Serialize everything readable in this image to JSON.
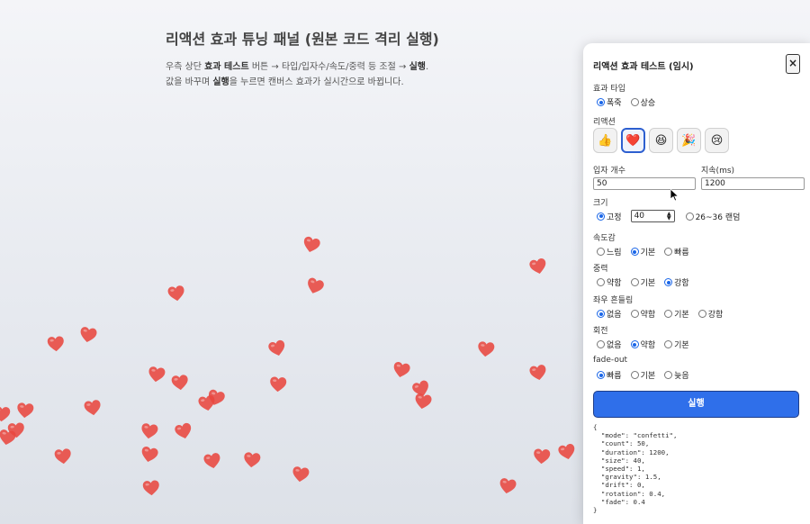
{
  "intro": {
    "title": "리액션 효과 튜닝 패널 (원본 코드 격리 실행)",
    "line1_a": "우측 상단 ",
    "line1_b": "효과 테스트",
    "line1_c": " 버튼 → 타입/입자수/속도/중력 등 조절 → ",
    "line1_d": "실행",
    "line1_e": ".",
    "line2_a": "값을 바꾸며 ",
    "line2_b": "실행",
    "line2_c": "을 누르면 캔버스 효과가 실시간으로 바뀝니다."
  },
  "panel": {
    "title": "리액션 효과 테스트 (임시)",
    "close_label": "×",
    "effect_type": {
      "label": "효과 타입",
      "opt1": "폭죽",
      "opt2": "상승"
    },
    "reaction": {
      "label": "리액션",
      "emojis": [
        "👍",
        "❤️",
        "😆",
        "🎉",
        "😢"
      ]
    },
    "count": {
      "label": "입자 개수",
      "value": "50"
    },
    "duration": {
      "label": "지속(ms)",
      "value": "1200"
    },
    "size": {
      "label": "크기",
      "fixed_label": "고정",
      "fixed_value": "40",
      "random_label": "26~36 랜덤"
    },
    "speed": {
      "label": "속도감",
      "opt1": "느림",
      "opt2": "기본",
      "opt3": "빠름"
    },
    "gravity": {
      "label": "중력",
      "opt1": "약함",
      "opt2": "기본",
      "opt3": "강함"
    },
    "drift": {
      "label": "좌우 흔들림",
      "opt1": "없음",
      "opt2": "약함",
      "opt3": "기본",
      "opt4": "강함"
    },
    "rotation": {
      "label": "회전",
      "opt1": "없음",
      "opt2": "약함",
      "opt3": "기본"
    },
    "fade": {
      "label": "fade-out",
      "opt1": "빠름",
      "opt2": "기본",
      "opt3": "늦음"
    },
    "run_label": "실행",
    "json_output": "{\n  \"mode\": \"confetti\",\n  \"count\": 50,\n  \"duration\": 1200,\n  \"size\": 40,\n  \"speed\": 1,\n  \"gravity\": 1.5,\n  \"drift\": 0,\n  \"rotation\": 0.4,\n  \"fade\": 0.4\n}"
  },
  "colors": {
    "accent": "#2f6fea",
    "heart": "#e8473f"
  },
  "icons": {
    "heart_particle": "heart-icon",
    "close": "close-icon",
    "cursor": "mouse-pointer-icon"
  }
}
